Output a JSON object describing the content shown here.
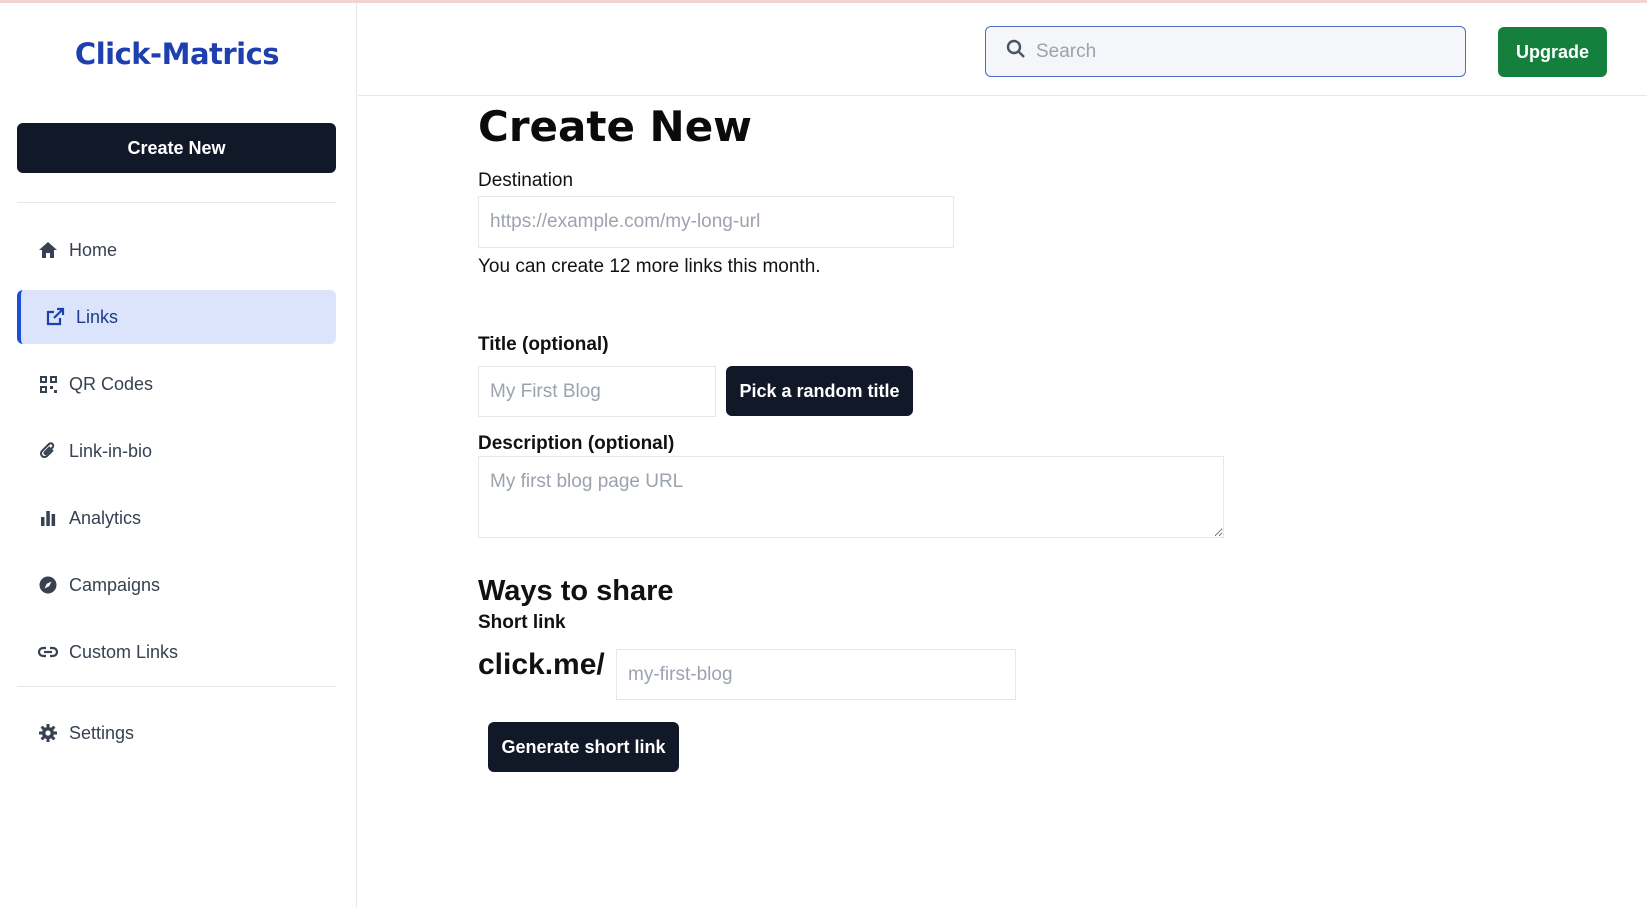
{
  "app": {
    "brand": "Click-Matrics"
  },
  "sidebar": {
    "create_label": "Create New",
    "items": [
      {
        "label": "Home",
        "icon": "home-icon"
      },
      {
        "label": "Links",
        "icon": "external-link-icon",
        "active": true
      },
      {
        "label": "QR Codes",
        "icon": "qr-code-icon"
      },
      {
        "label": "Link-in-bio",
        "icon": "paperclip-icon"
      },
      {
        "label": "Analytics",
        "icon": "bar-chart-icon"
      },
      {
        "label": "Campaigns",
        "icon": "compass-icon"
      },
      {
        "label": "Custom Links",
        "icon": "link-icon"
      }
    ],
    "settings_label": "Settings"
  },
  "header": {
    "search_placeholder": "Search",
    "upgrade_label": "Upgrade"
  },
  "form": {
    "title": "Create New",
    "destination_label": "Destination",
    "destination_placeholder": "https://example.com/my-long-url",
    "links_remaining": "You can create 12 more links this month.",
    "title_label": "Title",
    "optional": "(optional)",
    "title_placeholder": "My First Blog",
    "random_title_label": "Pick a random title",
    "description_label": "Description",
    "description_placeholder": "My first blog page URL",
    "share_heading": "Ways to share",
    "short_link_label": "Short link",
    "domain_prefix": "click.me/",
    "slug_placeholder": "my-first-blog",
    "generate_label": "Generate short link"
  },
  "colors": {
    "brand": "#1e40af",
    "primary_button": "#111827",
    "upgrade": "#15803d",
    "active_nav_bg": "#dbe4fb"
  }
}
